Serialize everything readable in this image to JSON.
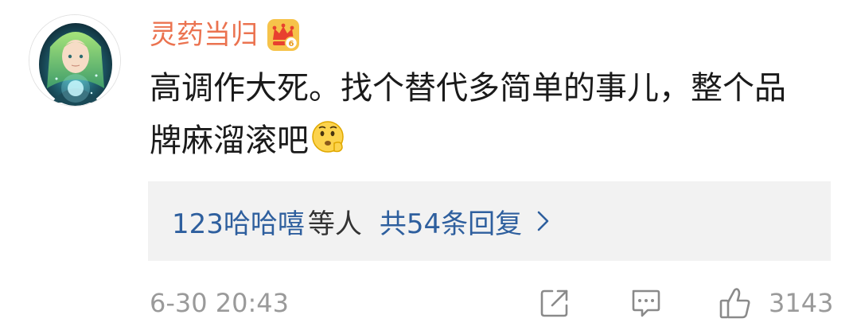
{
  "comment": {
    "username": "灵药当归",
    "text": "高调作大死。找个替代多简单的事儿，整个品牌麻溜滚吧",
    "avatar_icon": "anime-avatar",
    "vip_icon": "vip-crown-badge",
    "emoji_icon": "thinking-face-emoji",
    "username_color": "#eb7350"
  },
  "replies": {
    "names": "123哈哈嘻",
    "others": "等人",
    "count_label": "共54条回复",
    "chevron_icon": "chevron-right-icon",
    "link_color": "#2e5f9e"
  },
  "footer": {
    "timestamp": "6-30 20:43",
    "share_icon": "share-icon",
    "comment_icon": "comment-icon",
    "like_icon": "thumbs-up-icon",
    "like_count": "3143"
  }
}
